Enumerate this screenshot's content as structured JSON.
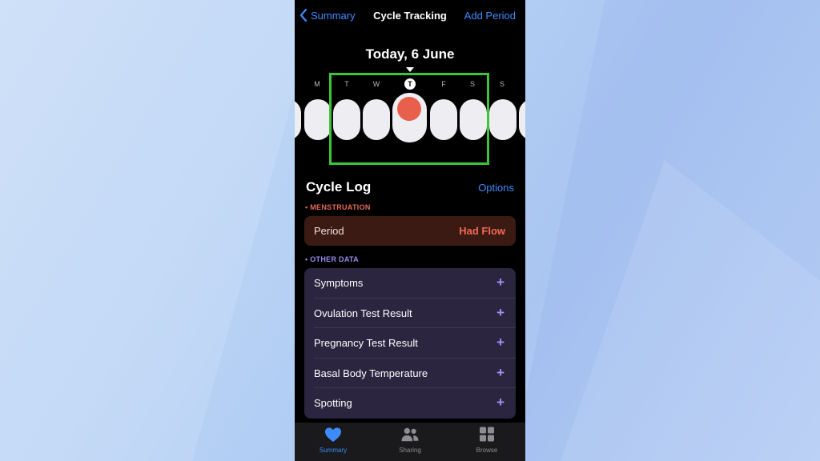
{
  "navbar": {
    "back_label": "Summary",
    "title": "Cycle Tracking",
    "action_label": "Add Period"
  },
  "calendar": {
    "date_heading": "Today, 6 June",
    "weekdays": [
      "M",
      "T",
      "W",
      "T",
      "F",
      "S",
      "S"
    ],
    "today_index": 3,
    "flow_color": "#e8604c"
  },
  "cycle_log": {
    "title": "Cycle Log",
    "options_label": "Options",
    "menstruation_label": "• MENSTRUATION",
    "period": {
      "label": "Period",
      "value": "Had Flow"
    },
    "other_label": "• OTHER DATA",
    "other_items": [
      {
        "label": "Symptoms"
      },
      {
        "label": "Ovulation Test Result"
      },
      {
        "label": "Pregnancy Test Result"
      },
      {
        "label": "Basal Body Temperature"
      },
      {
        "label": "Spotting"
      }
    ],
    "add_glyph": "+"
  },
  "tabbar": {
    "tabs": [
      {
        "label": "Summary",
        "icon": "heart-icon",
        "active": true
      },
      {
        "label": "Sharing",
        "icon": "people-icon",
        "active": false
      },
      {
        "label": "Browse",
        "icon": "grid-icon",
        "active": false
      }
    ]
  },
  "colors": {
    "accent": "#3d8bfd",
    "menstruation": "#e66a55",
    "other_data": "#9a8df0",
    "highlight_box": "#3ec43a"
  }
}
